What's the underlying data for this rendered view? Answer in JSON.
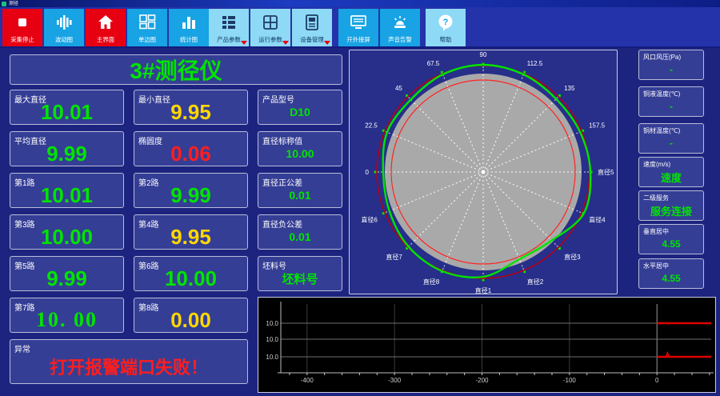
{
  "window": {
    "title": "测径"
  },
  "toolbar": {
    "items": [
      {
        "name": "stop-acquisition",
        "label": "采集停止",
        "icon": "stop",
        "style": "red",
        "dropdown": false
      },
      {
        "name": "fluctuation-chart",
        "label": "波动图",
        "icon": "wave",
        "style": "cyan",
        "dropdown": false
      },
      {
        "name": "main-screen",
        "label": "主界面",
        "icon": "home",
        "style": "red",
        "dropdown": false
      },
      {
        "name": "single-edge-chart",
        "label": "单边图",
        "icon": "panels",
        "style": "cyan",
        "dropdown": false
      },
      {
        "name": "statistics-chart",
        "label": "统计图",
        "icon": "stats",
        "style": "cyan",
        "dropdown": false
      },
      {
        "name": "product-params",
        "label": "产品参数",
        "icon": "listgrid",
        "style": "light",
        "dropdown": true
      },
      {
        "name": "run-params",
        "label": "运行参数",
        "icon": "grid",
        "style": "light",
        "dropdown": true
      },
      {
        "name": "device-management",
        "label": "设备管理",
        "icon": "device",
        "style": "light",
        "dropdown": true
      },
      {
        "name": "external-screen",
        "label": "开外接屏",
        "icon": "screen",
        "style": "cyan",
        "dropdown": false
      },
      {
        "name": "sound-alarm",
        "label": "声音告警",
        "icon": "alarm",
        "style": "cyan",
        "dropdown": false
      },
      {
        "name": "help",
        "label": "帮助",
        "icon": "help",
        "style": "light",
        "dropdown": false
      }
    ]
  },
  "left_panel": {
    "title": "3#测径仪",
    "rows": [
      [
        {
          "name": "max-diameter",
          "label": "最大直径",
          "value": "10.01",
          "color": "green",
          "size": "large"
        },
        {
          "name": "min-diameter",
          "label": "最小直径",
          "value": "9.95",
          "color": "yellow",
          "size": "large"
        },
        {
          "name": "product-model",
          "label": "产品型号",
          "value": "D10",
          "color": "green",
          "size": "small"
        }
      ],
      [
        {
          "name": "avg-diameter",
          "label": "平均直径",
          "value": "9.99",
          "color": "green",
          "size": "large"
        },
        {
          "name": "ovality",
          "label": "椭圆度",
          "value": "0.06",
          "color": "red",
          "size": "large"
        },
        {
          "name": "nominal-diameter",
          "label": "直径标称值",
          "value": "10.00",
          "color": "green",
          "size": "small"
        }
      ],
      [
        {
          "name": "path-1",
          "label": "第1路",
          "value": "10.01",
          "color": "green",
          "size": "large"
        },
        {
          "name": "path-2",
          "label": "第2路",
          "value": "9.99",
          "color": "green",
          "size": "large"
        },
        {
          "name": "plus-tolerance",
          "label": "直径正公差",
          "value": "0.01",
          "color": "green",
          "size": "small"
        }
      ],
      [
        {
          "name": "path-3",
          "label": "第3路",
          "value": "10.00",
          "color": "green",
          "size": "large"
        },
        {
          "name": "path-4",
          "label": "第4路",
          "value": "9.95",
          "color": "yellow",
          "size": "large"
        },
        {
          "name": "minus-tolerance",
          "label": "直径负公差",
          "value": "0.01",
          "color": "green",
          "size": "small"
        }
      ],
      [
        {
          "name": "path-5",
          "label": "第5路",
          "value": "9.99",
          "color": "green",
          "size": "large"
        },
        {
          "name": "path-6",
          "label": "第6路",
          "value": "10.00",
          "color": "green",
          "size": "large"
        },
        {
          "name": "billet-number",
          "label": "坯料号",
          "value": "坯料号",
          "color": "green",
          "size": "medium"
        }
      ],
      [
        {
          "name": "path-7",
          "label": "第7路",
          "value": "10. 00",
          "color": "green",
          "size": "large",
          "serif": true
        },
        {
          "name": "path-8",
          "label": "第8路",
          "value": "0.00",
          "color": "yellow",
          "size": "large"
        }
      ],
      [
        {
          "name": "exception",
          "label": "异常",
          "value": "打开报警端口失败！",
          "color": "red",
          "size": "exception",
          "wide": true
        }
      ]
    ]
  },
  "sidebar": {
    "fields": [
      {
        "name": "tuyere-pressure",
        "label": "风口风压(Pa)",
        "value": "-",
        "color": "green"
      },
      {
        "name": "copper-liquid-temp",
        "label": "铜液温度(℃)",
        "value": "-",
        "color": "green"
      },
      {
        "name": "copper-rod-temp",
        "label": "铜材温度(℃)",
        "value": "-",
        "color": "green"
      },
      {
        "name": "speed",
        "label": "速度(m/s)",
        "value": "速度",
        "color": "green"
      },
      {
        "name": "secondary-service",
        "label": "二级服务",
        "value": "服务连接",
        "color": "green"
      },
      {
        "name": "vertical-center",
        "label": "垂直居中",
        "value": "4.55",
        "color": "green"
      },
      {
        "name": "horizontal-center",
        "label": "水平居中",
        "value": "4.55",
        "color": "green"
      }
    ]
  },
  "chart_data": [
    {
      "type": "polar_profile",
      "description": "cross-section diameter profile of 3# gauge",
      "disc_color": "#a9a9a9",
      "outer_circle_color": "#b40018",
      "inner_circle_color": "#ff2222",
      "profile_color": "#00e400",
      "disc_r": 123,
      "outer_r": 133,
      "inner_r": 115,
      "spokes": [
        {
          "angle": 0,
          "label": "直径5"
        },
        {
          "angle": 22.5,
          "label": "157.5"
        },
        {
          "angle": 45,
          "label": "135"
        },
        {
          "angle": 67.5,
          "label": "112.5"
        },
        {
          "angle": 90,
          "label": "90"
        },
        {
          "angle": 112.5,
          "label": "67.5"
        },
        {
          "angle": 135,
          "label": "45"
        },
        {
          "angle": 157.5,
          "label": "22.5"
        },
        {
          "angle": 180,
          "label": "0"
        },
        {
          "angle": 202.5,
          "label": "直径6"
        },
        {
          "angle": 225,
          "label": "直径7"
        },
        {
          "angle": 247.5,
          "label": "直径8"
        },
        {
          "angle": 270,
          "label": "直径1"
        },
        {
          "angle": 292.5,
          "label": "直径2"
        },
        {
          "angle": 315,
          "label": "直径3"
        },
        {
          "angle": 337.5,
          "label": "直径4"
        }
      ],
      "profile_radii": [
        134,
        131,
        129,
        132,
        134,
        132,
        128,
        130,
        125,
        127,
        132,
        134,
        131,
        118,
        121,
        136
      ]
    },
    {
      "type": "line",
      "description": "diameter trend with tolerance limits",
      "bg": "#000000",
      "xlim": [
        -430,
        62
      ],
      "x_ticks": [
        -400,
        -300,
        -200,
        -100,
        0
      ],
      "y_tick_labels": [
        "10.0",
        "10.0",
        "10.0"
      ],
      "grid_color": "#3c3c3c",
      "hgrid_color": "#6f6f6f",
      "series": [
        {
          "name": "upper-limit",
          "color": "#e00000",
          "level": 0,
          "from_x": 0,
          "to_x": 62
        },
        {
          "name": "lower-limit",
          "color": "#e00000",
          "level": 2,
          "from_x": 0,
          "to_x": 62,
          "spike_x": 12
        }
      ]
    }
  ]
}
